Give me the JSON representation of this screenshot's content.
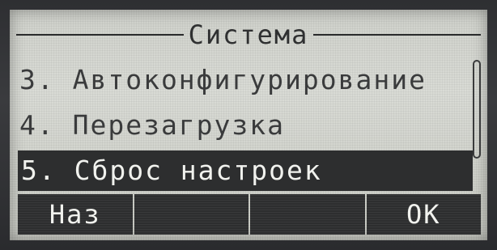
{
  "screen": {
    "title": "Система",
    "items": [
      {
        "label": "3. Автоконфигурирование",
        "selected": false
      },
      {
        "label": "4. Перезагрузка",
        "selected": false
      },
      {
        "label": "5. Сброс настроек",
        "selected": true
      }
    ]
  },
  "softkeys": [
    {
      "label": "Наз"
    },
    {
      "label": ""
    },
    {
      "label": ""
    },
    {
      "label": "ОК"
    }
  ],
  "colors": {
    "lcd_background": "#d4d6d0",
    "text": "#3a3b3c",
    "selection": "#2d2e2f",
    "bezel": "#2e2f32"
  }
}
